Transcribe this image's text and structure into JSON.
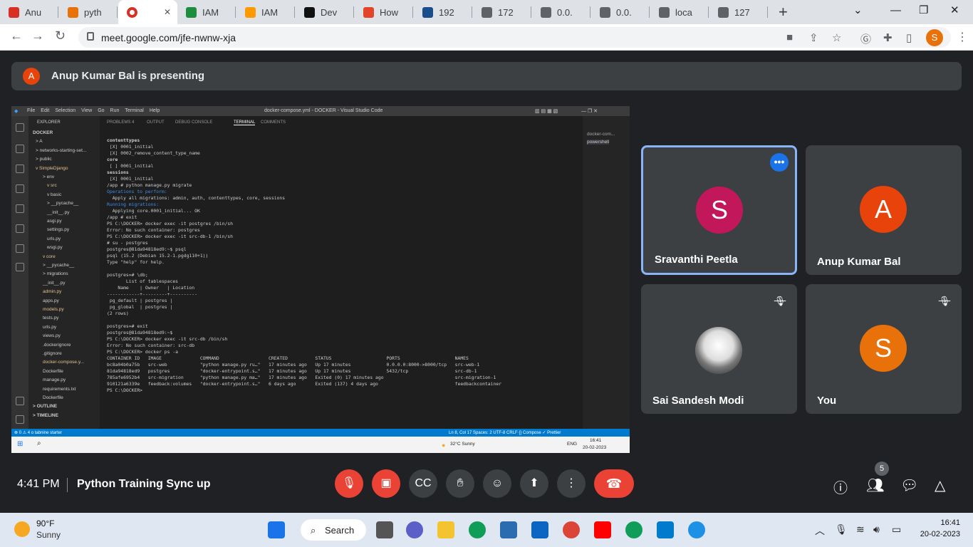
{
  "browser": {
    "tabs": [
      {
        "label": "Anu",
        "icon": "gmail-icon",
        "color": "#d93025"
      },
      {
        "label": "pyth",
        "icon": "python-icon",
        "color": "#e8710a"
      },
      {
        "label": "",
        "icon": "meet-icon",
        "color": "#00897b",
        "active": true
      },
      {
        "label": "IAM",
        "icon": "location-icon",
        "color": "#1e8e3e"
      },
      {
        "label": "IAM",
        "icon": "aws-icon",
        "color": "#ff9900"
      },
      {
        "label": "Dev",
        "icon": "github-icon",
        "color": "#111111"
      },
      {
        "label": "How",
        "icon": "gitlab-icon",
        "color": "#e24329"
      },
      {
        "label": "192",
        "icon": "globe-icon",
        "color": "#1a4d8c"
      },
      {
        "label": "172",
        "icon": "globe-icon",
        "color": "#5f6368"
      },
      {
        "label": "0.0.",
        "icon": "globe-icon",
        "color": "#5f6368"
      },
      {
        "label": "0.0.",
        "icon": "globe-icon",
        "color": "#5f6368"
      },
      {
        "label": "loca",
        "icon": "globe-icon",
        "color": "#5f6368"
      },
      {
        "label": "127",
        "icon": "globe-icon",
        "color": "#5f6368"
      }
    ],
    "url": "meet.google.com/jfe-nwnw-xja",
    "profile_initial": "S"
  },
  "meet": {
    "presenting_initial": "A",
    "presenting_text": "Anup Kumar Bal is presenting",
    "time": "4:41 PM",
    "meeting_name": "Python Training Sync up",
    "people_count": "5",
    "participants": [
      {
        "name": "Sravanthi Peetla",
        "initial": "S",
        "color": "#c2185b",
        "selected": true
      },
      {
        "name": "Anup Kumar Bal",
        "initial": "A",
        "color": "#e8430a"
      },
      {
        "name": "Sai Sandesh Modi",
        "initial": "",
        "color": "#555555",
        "muted": true
      },
      {
        "name": "You",
        "initial": "S",
        "color": "#e8710a",
        "muted": true
      }
    ]
  },
  "vscode": {
    "title": "docker-compose.yml - DOCKER - Visual Studio Code",
    "menu": [
      "File",
      "Edit",
      "Selection",
      "View",
      "Go",
      "Run",
      "Terminal",
      "Help"
    ],
    "explorer_header": "EXPLORER",
    "tree": [
      "DOCKER",
      "> A",
      "> networks-starting-set...",
      "> public",
      "v SimpleDjango",
      "> env",
      "v src",
      "v basic",
      "> __pycache__",
      "__init__.py",
      "asgi.py",
      "settings.py",
      "urls.py",
      "wsgi.py",
      "v core",
      "> __pycache__",
      "> migrations",
      "__init__.py",
      "admin.py",
      "apps.py",
      "models.py",
      "tests.py",
      "urls.py",
      "views.py",
      ".dockerignore",
      ".gitignore",
      "docker-compose.y...",
      "Dockerfile",
      "manage.py",
      "requirements.txt",
      "Dockerfile",
      "> OUTLINE",
      "> TIMELINE"
    ],
    "panel_tabs": [
      "PROBLEMS 4",
      "OUTPUT",
      "DEBUG CONSOLE",
      "TERMINAL",
      "COMMENTS"
    ],
    "terminal_lines": [
      "contenttypes",
      " [X] 0001_initial",
      " [X] 0002_remove_content_type_name",
      "core",
      " [ ] 0001_initial",
      "sessions",
      " [X] 0001_initial",
      "/app # python manage.py migrate",
      "Operations to perform:",
      "  Apply all migrations: admin, auth, contenttypes, core, sessions",
      "Running migrations:",
      "  Applying core.0001_initial... OK",
      "/app # exit",
      "PS C:\\DOCKER> docker exec -it postgres /bin/sh",
      "Error: No such container: postgres",
      "PS C:\\DOCKER> docker exec -it src-db-1 /bin/sh",
      "# su - postgres",
      "postgres@81da94818ed9:~$ psql",
      "psql (15.2 (Debian 15.2-1.pgdg110+1))",
      "Type \"help\" for help.",
      "",
      "postgres=# \\db;",
      "       List of tablespaces",
      "    Name    | Owner   | Location",
      "------------+---------+----------",
      " pg_default | postgres |",
      " pg_global  | postgres |",
      "(2 rows)",
      "",
      "postgres=# exit",
      "postgres@81da94818ed9:~$",
      "PS C:\\DOCKER> docker exec -it src-db /bin/sh",
      "Error: No such container: src-db",
      "PS C:\\DOCKER> docker ps -a",
      "CONTAINER ID   IMAGE              COMMAND                  CREATED          STATUS                    PORTS                    NAMES",
      "bc8a04b0a75b   src-web            \"python manage.py ru…\"   17 minutes ago   Up 17 minutes             0.0.0.0:8000->8000/tcp   src-web-1",
      "81da94818ed9   postgres           \"docker-entrypoint.s…\"   17 minutes ago   Up 17 minutes             5432/tcp                 src-db-1",
      "785afe6952b4   src-migration      \"python manage.py ma…\"   17 minutes ago   Exited (0) 17 minutes ago                          src-migration-1",
      "910121a6339e   feedback:volumes   \"docker-entrypoint.s…\"   6 days ago       Exited (137) 4 days ago                            feedbackcontainer",
      "PS C:\\DOCKER> "
    ],
    "side_items": [
      "docker-com...",
      "powershell"
    ],
    "status_left": "⊗ 0 ⚠ 4   o tabnine starter",
    "status_right": "Ln 8, Col 17   Spaces: 2   UTF-8   CRLF   {} Compose   ✓ Prettier",
    "inner_taskbar_weather": "32°C  Sunny",
    "inner_taskbar_lang": "ENG",
    "inner_taskbar_time": "16:41",
    "inner_taskbar_date": "20-02-2023"
  },
  "taskbar": {
    "temp": "90°F",
    "condition": "Sunny",
    "search_label": "Search",
    "time": "16:41",
    "date": "20-02-2023"
  }
}
